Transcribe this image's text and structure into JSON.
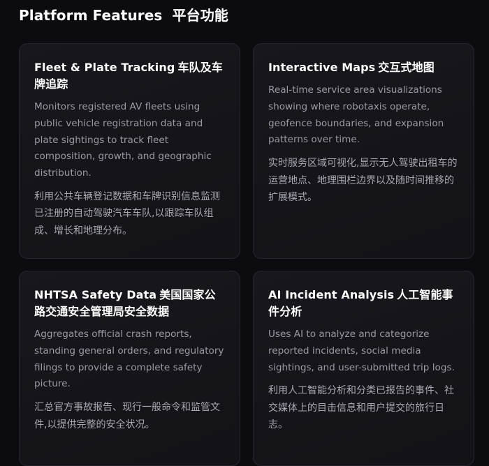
{
  "section": {
    "title": "Platform Features  平台功能"
  },
  "cards": [
    {
      "title_en": "Fleet & Plate Tracking",
      "title_zh": "车队及车牌追踪",
      "desc_en": "Monitors registered AV fleets using public vehicle registration data and plate sightings to track fleet composition, growth, and geographic distribution.",
      "desc_zh": "利用公共车辆登记数据和车牌识别信息监测已注册的自动驾驶汽车车队,以跟踪车队组成、增长和地理分布。"
    },
    {
      "title_en": "Interactive Maps",
      "title_zh": "交互式地图",
      "desc_en": "Real-time service area visualizations showing where robotaxis operate, geofence boundaries, and expansion patterns over time.",
      "desc_zh": "实时服务区域可视化,显示无人驾驶出租车的运营地点、地理围栏边界以及随时间推移的扩展模式。"
    },
    {
      "title_en": "NHTSA Safety Data",
      "title_zh": "美国国家公路交通安全管理局安全数据",
      "desc_en": "Aggregates official crash reports, standing general orders, and regulatory filings to provide a complete safety picture.",
      "desc_zh": "汇总官方事故报告、现行一般命令和监管文件,以提供完整的安全状况。"
    },
    {
      "title_en": "AI Incident Analysis",
      "title_zh": "人工智能事件分析",
      "desc_en": "Uses AI to analyze and categorize reported incidents, social media sightings, and user-submitted trip logs.",
      "desc_zh": "利用人工智能分析和分类已报告的事件、社交媒体上的目击信息和用户提交的旅行日志。"
    }
  ]
}
